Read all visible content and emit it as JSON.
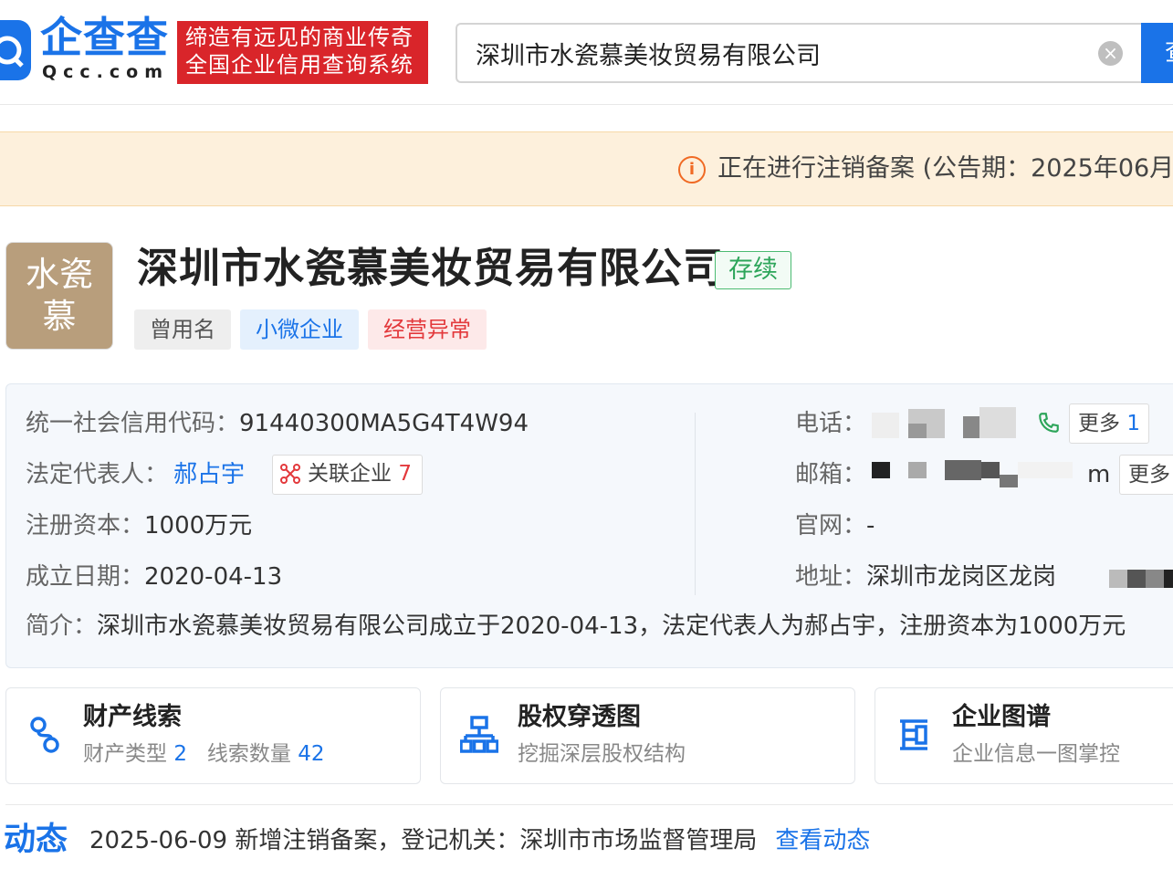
{
  "header": {
    "logo_text": "企查查",
    "logo_sub": "Qcc.com",
    "slogan_line1": "缔造有远见的商业传奇",
    "slogan_line2": "全国企业信用查询系统",
    "search_value": "深圳市水瓷慕美妆贸易有限公司",
    "search_button": "查"
  },
  "notice": {
    "text": "正在进行注销备案 (公告期：2025年06月"
  },
  "company": {
    "avatar_line1": "水瓷",
    "avatar_line2": "慕",
    "name": "深圳市水瓷慕美妆贸易有限公司",
    "status": "存续",
    "tags": [
      "曾用名",
      "小微企业",
      "经营异常"
    ]
  },
  "info": {
    "credit_code_label": "统一社会信用代码：",
    "credit_code": "91440300MA5G4T4W94",
    "legal_rep_label": "法定代表人：",
    "legal_rep": "郝占宇",
    "related_label": "关联企业",
    "related_count": "7",
    "capital_label": "注册资本：",
    "capital": "1000万元",
    "founded_label": "成立日期：",
    "founded": "2020-04-13",
    "phone_label": "电话：",
    "phone_more": "更多",
    "phone_more_count": "1",
    "email_label": "邮箱：",
    "email_suffix": "m",
    "email_more": "更多",
    "website_label": "官网：",
    "website": "-",
    "address_label": "地址：",
    "address": "深圳市龙岗区龙岗",
    "intro_label": "简介：",
    "intro": "深圳市水瓷慕美妆贸易有限公司成立于2020-04-13，法定代表人为郝占宇，注册资本为1000万元"
  },
  "cards": [
    {
      "title": "财产线索",
      "sub1": "财产类型",
      "num1": "2",
      "sub2": "线索数量",
      "num2": "42",
      "icon": "link-chain-icon"
    },
    {
      "title": "股权穿透图",
      "sub": "挖掘深层股权结构",
      "icon": "org-structure-icon"
    },
    {
      "title": "企业图谱",
      "sub": "企业信息一图掌控",
      "icon": "graph-icon"
    }
  ],
  "dynamic": {
    "title": "动态",
    "text": "2025-06-09 新增注销备案，登记机关：深圳市市场监督管理局",
    "link": "查看动态"
  },
  "colors": {
    "brand_blue": "#1a73e8",
    "slogan_red": "#d9252a",
    "status_green": "#2da55a",
    "warning_orange": "#f06a24",
    "notice_bg": "#fdf0dc"
  }
}
